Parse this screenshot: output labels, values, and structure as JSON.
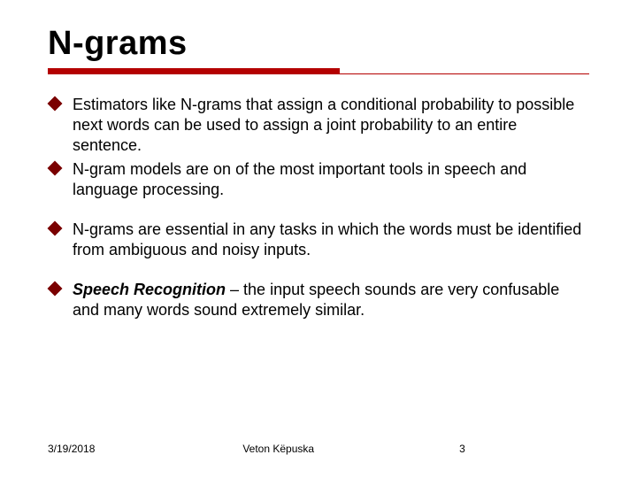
{
  "title": "N-grams",
  "bullets": [
    {
      "text": "Estimators like N-grams that assign a conditional probability to possible next words can be used to assign a joint probability to an entire sentence."
    },
    {
      "text": "N-gram models are on of the most important tools in speech and language processing."
    },
    {
      "text": "N-grams are essential in any tasks in which the words must be identified from ambiguous and noisy inputs."
    },
    {
      "bold_lead": "Speech Recognition",
      "text": " – the input speech sounds are very confusable and many words sound extremely similar."
    }
  ],
  "footer": {
    "date": "3/19/2018",
    "author": "Veton Këpuska",
    "page": "3"
  }
}
